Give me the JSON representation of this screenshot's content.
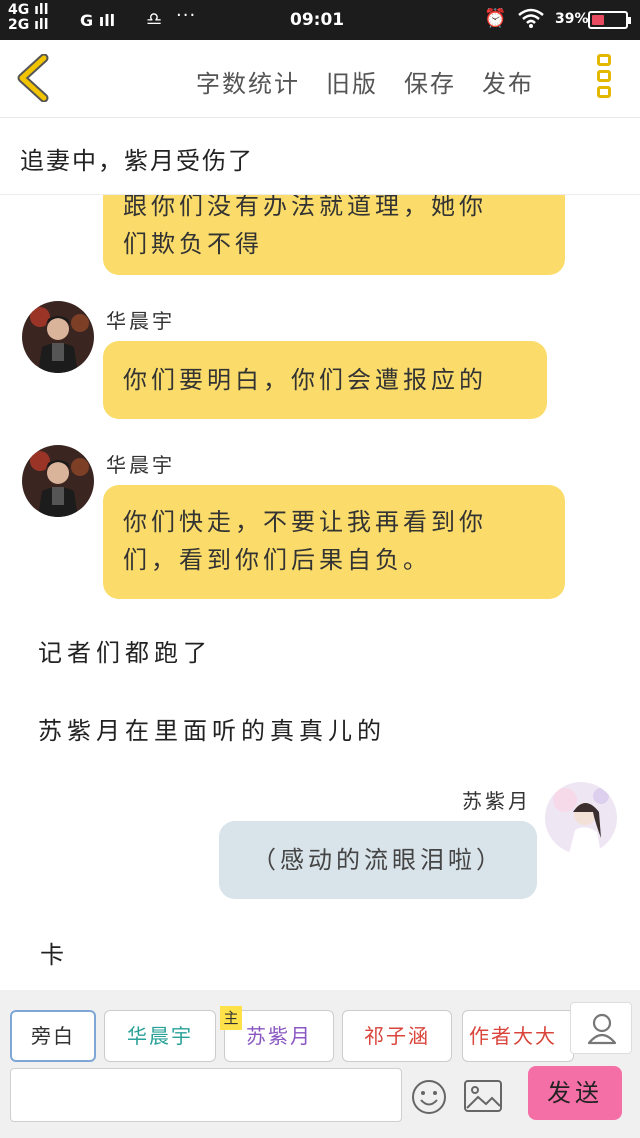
{
  "status_bar": {
    "network_1": "4G",
    "network_2": "2G",
    "carrier": "G",
    "time": "09:01",
    "battery_pct": "39",
    "battery_level": 0.39
  },
  "header": {
    "actions": [
      "字数统计",
      "旧版",
      "保存",
      "发布"
    ]
  },
  "chapter": {
    "title": "追妻中，紫月受伤了"
  },
  "chat": {
    "partial_bubble": {
      "line1": "跟你们没有办法就道理，她你",
      "line2": "们欺负不得"
    },
    "messages": [
      {
        "speaker": "华晨宇",
        "lines": [
          "你们要明白，你们会遭报应的"
        ]
      },
      {
        "speaker": "华晨宇",
        "lines": [
          "你们快走，不要让我再看到你",
          "们，看到你们后果自负。"
        ]
      }
    ],
    "narrations": [
      "记者们都跑了",
      "苏紫月在里面听的真真儿的"
    ],
    "right_message": {
      "speaker": "苏紫月",
      "text": "（感动的流眼泪啦）"
    },
    "last_narration": "卡"
  },
  "toolbar": {
    "characters": [
      "旁白",
      "华晨宇",
      "苏紫月",
      "祁子涵",
      "作者大大"
    ],
    "main_tag": "主",
    "char_colors": [
      "#333333",
      "#2aa198",
      "#8a57c2",
      "#d9443b",
      "#d9443b"
    ],
    "input_placeholder": "",
    "send_label": "发送"
  }
}
